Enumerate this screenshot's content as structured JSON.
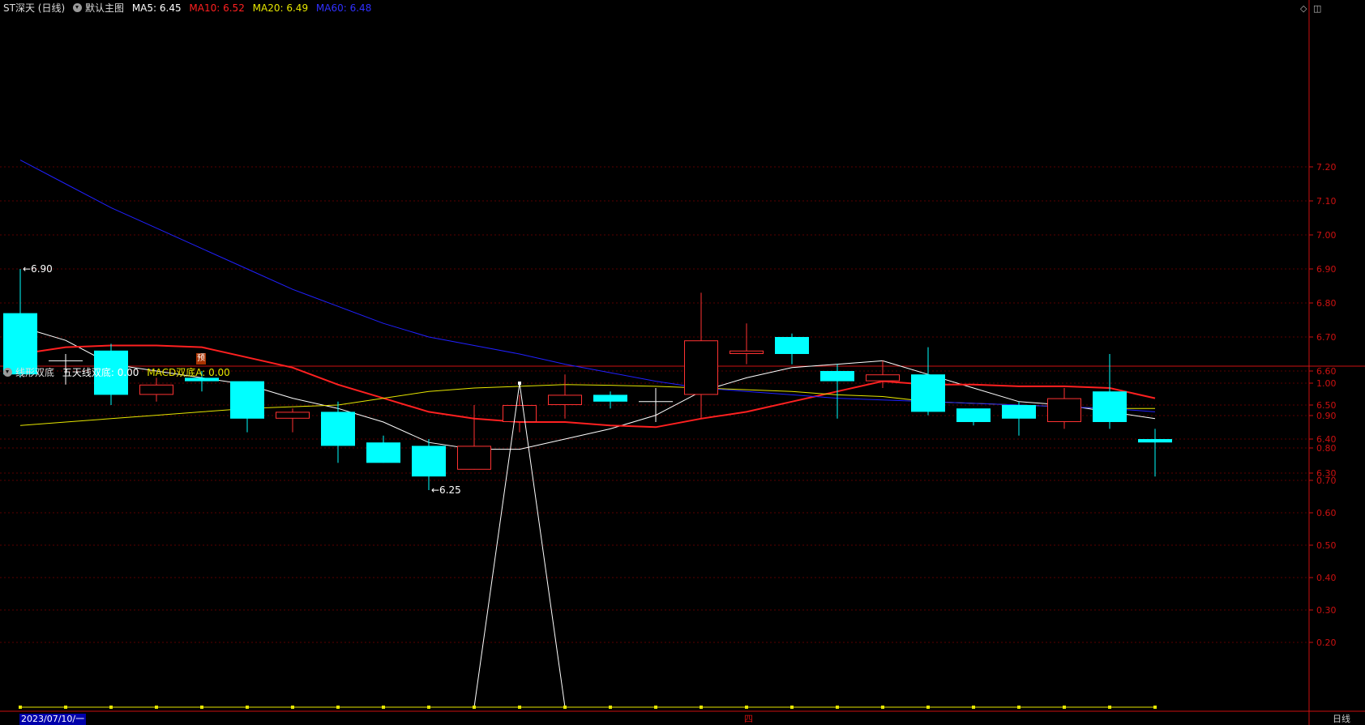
{
  "main_header": {
    "symbol": "ST深天 (日线)",
    "template": "默认主图",
    "ma5": "MA5: 6.45",
    "ma10": "MA10: 6.52",
    "ma20": "MA20: 6.49",
    "ma60": "MA60: 6.48"
  },
  "sub_header": {
    "indicator": "线形双底",
    "value_a": "五天线双底: 0.00",
    "value_b": "MACD双底A: 0.00"
  },
  "footer": {
    "date": "2023/07/10/一",
    "period": "日线",
    "marker": "四"
  },
  "pred_label": "预",
  "colors": {
    "up": "#ff3232",
    "down": "#00ffff",
    "ma5": "#ffffff",
    "ma10": "#ff2020",
    "ma20": "#e6e600",
    "ma60": "#2020ff",
    "axis": "#cc1111",
    "grid": "#5a0000"
  },
  "chart_data": [
    {
      "type": "candlestick",
      "title": "ST深天 (日线)",
      "ylim": [
        6.2,
        7.25
      ],
      "y_ticks": [
        "7.20",
        "7.10",
        "7.00",
        "6.90",
        "6.80",
        "6.70",
        "6.60",
        "6.50",
        "6.40",
        "6.30"
      ],
      "annotations": [
        {
          "label": "6.90",
          "index": 0,
          "value": 6.9
        },
        {
          "label": "6.25",
          "index": 9,
          "value": 6.25
        }
      ],
      "candles": [
        {
          "o": 6.77,
          "h": 6.9,
          "l": 6.58,
          "c": 6.59
        },
        {
          "o": 6.63,
          "h": 6.65,
          "l": 6.56,
          "c": 6.63
        },
        {
          "o": 6.66,
          "h": 6.68,
          "l": 6.5,
          "c": 6.53
        },
        {
          "o": 6.53,
          "h": 6.58,
          "l": 6.51,
          "c": 6.56
        },
        {
          "o": 6.58,
          "h": 6.6,
          "l": 6.54,
          "c": 6.57
        },
        {
          "o": 6.57,
          "h": 6.57,
          "l": 6.42,
          "c": 6.46
        },
        {
          "o": 6.46,
          "h": 6.49,
          "l": 6.42,
          "c": 6.48
        },
        {
          "o": 6.48,
          "h": 6.51,
          "l": 6.33,
          "c": 6.38
        },
        {
          "o": 6.39,
          "h": 6.41,
          "l": 6.33,
          "c": 6.33
        },
        {
          "o": 6.38,
          "h": 6.4,
          "l": 6.25,
          "c": 6.29
        },
        {
          "o": 6.31,
          "h": 6.5,
          "l": 6.31,
          "c": 6.38
        },
        {
          "o": 6.45,
          "h": 6.53,
          "l": 6.42,
          "c": 6.5
        },
        {
          "o": 6.5,
          "h": 6.59,
          "l": 6.46,
          "c": 6.53
        },
        {
          "o": 6.53,
          "h": 6.54,
          "l": 6.49,
          "c": 6.51
        },
        {
          "o": 6.51,
          "h": 6.55,
          "l": 6.45,
          "c": 6.51
        },
        {
          "o": 6.53,
          "h": 6.83,
          "l": 6.46,
          "c": 6.69
        },
        {
          "o": 6.65,
          "h": 6.74,
          "l": 6.62,
          "c": 6.66
        },
        {
          "o": 6.7,
          "h": 6.71,
          "l": 6.62,
          "c": 6.65
        },
        {
          "o": 6.6,
          "h": 6.62,
          "l": 6.46,
          "c": 6.57
        },
        {
          "o": 6.57,
          "h": 6.63,
          "l": 6.55,
          "c": 6.59
        },
        {
          "o": 6.59,
          "h": 6.67,
          "l": 6.47,
          "c": 6.48
        },
        {
          "o": 6.49,
          "h": 6.49,
          "l": 6.44,
          "c": 6.45
        },
        {
          "o": 6.5,
          "h": 6.51,
          "l": 6.41,
          "c": 6.46
        },
        {
          "o": 6.45,
          "h": 6.55,
          "l": 6.43,
          "c": 6.52
        },
        {
          "o": 6.54,
          "h": 6.65,
          "l": 6.43,
          "c": 6.45
        },
        {
          "o": 6.4,
          "h": 6.43,
          "l": 6.29,
          "c": 6.39
        }
      ],
      "series": [
        {
          "name": "MA5",
          "values": [
            6.73,
            6.69,
            6.62,
            6.6,
            6.58,
            6.56,
            6.52,
            6.49,
            6.45,
            6.39,
            6.37,
            6.37,
            6.4,
            6.43,
            6.47,
            6.54,
            6.58,
            6.61,
            6.62,
            6.63,
            6.59,
            6.55,
            6.51,
            6.5,
            6.48,
            6.46
          ]
        },
        {
          "name": "MA10",
          "values": [
            6.65,
            6.67,
            6.675,
            6.675,
            6.67,
            6.64,
            6.61,
            6.56,
            6.52,
            6.48,
            6.46,
            6.45,
            6.45,
            6.44,
            6.435,
            6.46,
            6.48,
            6.51,
            6.54,
            6.57,
            6.56,
            6.56,
            6.555,
            6.555,
            6.55,
            6.52
          ]
        },
        {
          "name": "MA20",
          "values": [
            6.44,
            6.45,
            6.46,
            6.47,
            6.48,
            6.49,
            6.495,
            6.5,
            6.52,
            6.54,
            6.55,
            6.555,
            6.56,
            6.558,
            6.555,
            6.55,
            6.545,
            6.54,
            6.53,
            6.525,
            6.51,
            6.505,
            6.5,
            6.495,
            6.49,
            6.49
          ]
        },
        {
          "name": "MA60",
          "values": [
            7.22,
            7.15,
            7.08,
            7.02,
            6.96,
            6.9,
            6.84,
            6.79,
            6.74,
            6.7,
            6.675,
            6.65,
            6.62,
            6.595,
            6.57,
            6.55,
            6.54,
            6.53,
            6.52,
            6.515,
            6.51,
            6.505,
            6.5,
            6.495,
            6.49,
            6.48
          ]
        }
      ]
    },
    {
      "type": "line",
      "ylim": [
        0,
        1.05
      ],
      "y_ticks": [
        "1.00",
        "0.90",
        "0.80",
        "0.70",
        "0.60",
        "0.50",
        "0.40",
        "0.30",
        "0.20"
      ],
      "series": [
        {
          "name": "五天线双底",
          "values": [
            0,
            0,
            0,
            0,
            0,
            0,
            0,
            0,
            0,
            0,
            0,
            1,
            0,
            0,
            0,
            0,
            0,
            0,
            0,
            0,
            0,
            0,
            0,
            0,
            0,
            0
          ]
        },
        {
          "name": "MACD双底A",
          "values": [
            0,
            0,
            0,
            0,
            0,
            0,
            0,
            0,
            0,
            0,
            0,
            0,
            0,
            0,
            0,
            0,
            0,
            0,
            0,
            0,
            0,
            0,
            0,
            0,
            0,
            0
          ]
        }
      ]
    }
  ]
}
